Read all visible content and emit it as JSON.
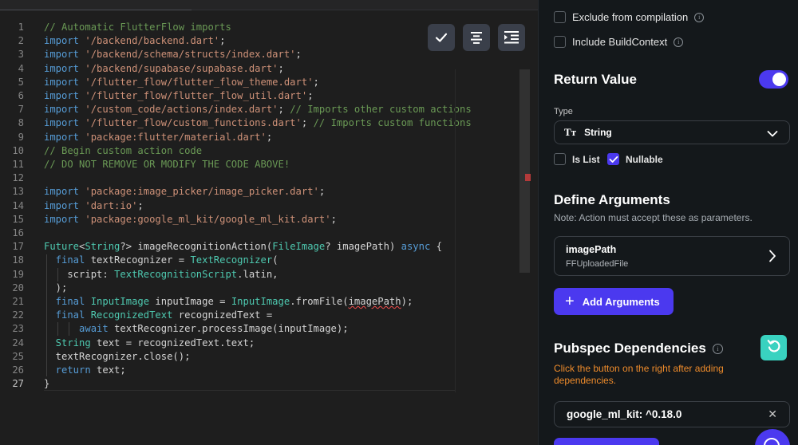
{
  "editor": {
    "toolbar": {
      "check_icon": "check-icon",
      "align_center_icon": "align-center-icon",
      "format_indent_icon": "format-indent-icon"
    },
    "lines": [
      {
        "n": "1",
        "tokens": [
          {
            "t": "// Automatic FlutterFlow imports",
            "c": "com"
          }
        ]
      },
      {
        "n": "2",
        "tokens": [
          {
            "t": "import ",
            "c": "kw"
          },
          {
            "t": "'/backend/backend.dart'",
            "c": "str"
          },
          {
            "t": ";",
            "c": "var"
          }
        ]
      },
      {
        "n": "3",
        "tokens": [
          {
            "t": "import ",
            "c": "kw"
          },
          {
            "t": "'/backend/schema/structs/index.dart'",
            "c": "str"
          },
          {
            "t": ";",
            "c": "var"
          }
        ]
      },
      {
        "n": "4",
        "tokens": [
          {
            "t": "import ",
            "c": "kw"
          },
          {
            "t": "'/backend/supabase/supabase.dart'",
            "c": "str"
          },
          {
            "t": ";",
            "c": "var"
          }
        ]
      },
      {
        "n": "5",
        "tokens": [
          {
            "t": "import ",
            "c": "kw"
          },
          {
            "t": "'/flutter_flow/flutter_flow_theme.dart'",
            "c": "str"
          },
          {
            "t": ";",
            "c": "var"
          }
        ]
      },
      {
        "n": "6",
        "tokens": [
          {
            "t": "import ",
            "c": "kw"
          },
          {
            "t": "'/flutter_flow/flutter_flow_util.dart'",
            "c": "str"
          },
          {
            "t": ";",
            "c": "var"
          }
        ]
      },
      {
        "n": "7",
        "tokens": [
          {
            "t": "import ",
            "c": "kw"
          },
          {
            "t": "'/custom_code/actions/index.dart'",
            "c": "str"
          },
          {
            "t": "; ",
            "c": "var"
          },
          {
            "t": "// Imports other custom actions",
            "c": "com"
          }
        ]
      },
      {
        "n": "8",
        "tokens": [
          {
            "t": "import ",
            "c": "kw"
          },
          {
            "t": "'/flutter_flow/custom_functions.dart'",
            "c": "str"
          },
          {
            "t": "; ",
            "c": "var"
          },
          {
            "t": "// Imports custom functions",
            "c": "com"
          }
        ]
      },
      {
        "n": "9",
        "tokens": [
          {
            "t": "import ",
            "c": "kw"
          },
          {
            "t": "'package:flutter/material.dart'",
            "c": "str"
          },
          {
            "t": ";",
            "c": "var"
          }
        ]
      },
      {
        "n": "10",
        "tokens": [
          {
            "t": "// Begin custom action code",
            "c": "com"
          }
        ]
      },
      {
        "n": "11",
        "tokens": [
          {
            "t": "// DO NOT REMOVE OR MODIFY THE CODE ABOVE!",
            "c": "com"
          }
        ]
      },
      {
        "n": "12",
        "tokens": []
      },
      {
        "n": "13",
        "tokens": [
          {
            "t": "import ",
            "c": "kw"
          },
          {
            "t": "'package:image_picker/image_picker.dart'",
            "c": "str"
          },
          {
            "t": ";",
            "c": "var"
          }
        ]
      },
      {
        "n": "14",
        "tokens": [
          {
            "t": "import ",
            "c": "kw"
          },
          {
            "t": "'dart:io'",
            "c": "str"
          },
          {
            "t": ";",
            "c": "var"
          }
        ]
      },
      {
        "n": "15",
        "tokens": [
          {
            "t": "import ",
            "c": "kw"
          },
          {
            "t": "'package:google_ml_kit/google_ml_kit.dart'",
            "c": "str"
          },
          {
            "t": ";",
            "c": "var"
          }
        ]
      },
      {
        "n": "16",
        "tokens": []
      },
      {
        "n": "17",
        "tokens": [
          {
            "t": "Future",
            "c": "type"
          },
          {
            "t": "<",
            "c": "var"
          },
          {
            "t": "String",
            "c": "type"
          },
          {
            "t": "?> imageRecognitionAction(",
            "c": "var"
          },
          {
            "t": "FileImage",
            "c": "type"
          },
          {
            "t": "? imagePath) ",
            "c": "var"
          },
          {
            "t": "async",
            "c": "kw"
          },
          {
            "t": " {",
            "c": "var"
          }
        ]
      },
      {
        "n": "18",
        "tokens": [
          {
            "t": "  final ",
            "c": "kw"
          },
          {
            "t": "textRecognizer = ",
            "c": "var"
          },
          {
            "t": "TextRecognizer",
            "c": "type"
          },
          {
            "t": "(",
            "c": "var"
          }
        ]
      },
      {
        "n": "19",
        "tokens": [
          {
            "t": "    script: ",
            "c": "var"
          },
          {
            "t": "TextRecognitionScript",
            "c": "type"
          },
          {
            "t": ".latin,",
            "c": "var"
          }
        ]
      },
      {
        "n": "20",
        "tokens": [
          {
            "t": "  );",
            "c": "var"
          }
        ]
      },
      {
        "n": "21",
        "tokens": [
          {
            "t": "  final ",
            "c": "kw"
          },
          {
            "t": "InputImage",
            "c": "type"
          },
          {
            "t": " inputImage = ",
            "c": "var"
          },
          {
            "t": "InputImage",
            "c": "type"
          },
          {
            "t": ".fromFile(",
            "c": "var"
          },
          {
            "t": "imagePath",
            "c": "squig"
          },
          {
            "t": ");",
            "c": "var"
          }
        ]
      },
      {
        "n": "22",
        "tokens": [
          {
            "t": "  final ",
            "c": "kw"
          },
          {
            "t": "RecognizedText",
            "c": "type"
          },
          {
            "t": " recognizedText =",
            "c": "var"
          }
        ]
      },
      {
        "n": "23",
        "tokens": [
          {
            "t": "      await ",
            "c": "kw"
          },
          {
            "t": "textRecognizer.processImage(inputImage);",
            "c": "var"
          }
        ]
      },
      {
        "n": "24",
        "tokens": [
          {
            "t": "  String ",
            "c": "type"
          },
          {
            "t": "text = recognizedText.text;",
            "c": "var"
          }
        ]
      },
      {
        "n": "25",
        "tokens": [
          {
            "t": "  textRecognizer.close();",
            "c": "var"
          }
        ]
      },
      {
        "n": "26",
        "tokens": [
          {
            "t": "  return ",
            "c": "kw"
          },
          {
            "t": "text;",
            "c": "var"
          }
        ]
      },
      {
        "n": "27",
        "tokens": [
          {
            "t": "}",
            "c": "var"
          }
        ]
      }
    ]
  },
  "panel": {
    "exclude_label": "Exclude from compilation",
    "include_label": "Include BuildContext",
    "info_glyph": "i",
    "return_value": {
      "title": "Return Value",
      "toggle_on": true,
      "type_label": "Type",
      "type_icon": "Tт",
      "type_value": "String",
      "is_list_label": "Is List",
      "is_list_checked": false,
      "nullable_label": "Nullable",
      "nullable_checked": true
    },
    "arguments": {
      "title": "Define Arguments",
      "note": "Note: Action must accept these as parameters.",
      "items": [
        {
          "name": "imagePath",
          "type": "FFUploadedFile"
        }
      ],
      "add_label": "Add Arguments",
      "add_glyph": "+"
    },
    "pubspec": {
      "title": "Pubspec Dependencies",
      "warning": "Click the button on the right after adding dependencies.",
      "dependency": "google_ml_kit: ^0.18.0",
      "clear_glyph": "✕"
    },
    "colors": {
      "accent": "#4b39ef",
      "warning": "#ee8b2b",
      "refresh": "#39d2c0"
    }
  }
}
